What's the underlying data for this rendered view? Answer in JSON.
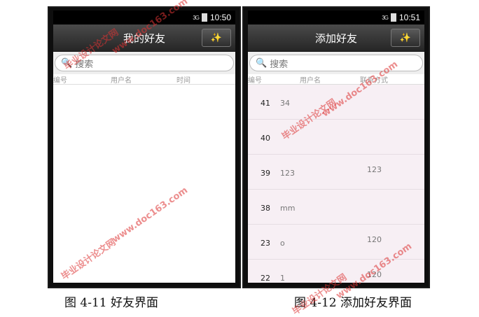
{
  "phone1": {
    "status": {
      "network": "3G",
      "time": "10:50"
    },
    "title": "我的好友",
    "action_icon": "wand-icon",
    "search_placeholder": "搜索",
    "columns": [
      "编号",
      "用户名",
      "时间"
    ]
  },
  "phone2": {
    "status": {
      "network": "3G",
      "time": "10:51"
    },
    "title": "添加好友",
    "action_icon": "wand-icon",
    "search_placeholder": "搜索",
    "columns": [
      "编号",
      "用户名",
      "联系方式"
    ],
    "rows": [
      {
        "id": "41",
        "name": "34",
        "contact": ""
      },
      {
        "id": "40",
        "name": "",
        "contact": ""
      },
      {
        "id": "39",
        "name": "123",
        "contact": "123"
      },
      {
        "id": "38",
        "name": "mm",
        "contact": ""
      },
      {
        "id": "23",
        "name": "o",
        "contact": "120"
      },
      {
        "id": "22",
        "name": "1",
        "contact": "120"
      }
    ]
  },
  "captions": {
    "left": "图 4-11  好友界面",
    "right": "图 4-12  添加好友界面"
  },
  "watermarks": {
    "site": "www.doc163.com",
    "name": "毕业设计论文网"
  }
}
